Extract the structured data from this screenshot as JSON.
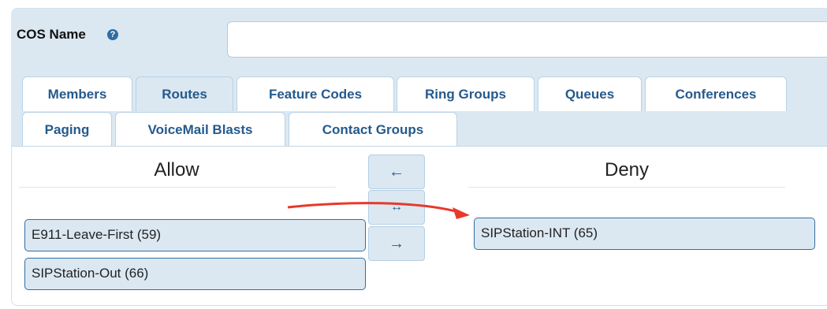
{
  "cos_name": {
    "label": "COS Name",
    "help_icon": "?",
    "value": ""
  },
  "tabs": [
    {
      "label": "Members"
    },
    {
      "label": "Routes",
      "active": true
    },
    {
      "label": "Feature Codes"
    },
    {
      "label": "Ring Groups"
    },
    {
      "label": "Queues"
    },
    {
      "label": "Conferences"
    },
    {
      "label": "Paging"
    },
    {
      "label": "VoiceMail Blasts"
    },
    {
      "label": "Contact Groups"
    }
  ],
  "allow": {
    "title": "Allow",
    "items": [
      "E911-Leave-First (59)",
      "SIPStation-Out (66)"
    ]
  },
  "deny": {
    "title": "Deny",
    "items": [
      "SIPStation-INT (65)"
    ]
  },
  "controls": {
    "move_left": "←",
    "swap": "↔",
    "move_right": "→"
  },
  "colors": {
    "accent": "#255a8c",
    "panel_bg": "#dbe8f2",
    "annotation_arrow": "#e8392b"
  }
}
